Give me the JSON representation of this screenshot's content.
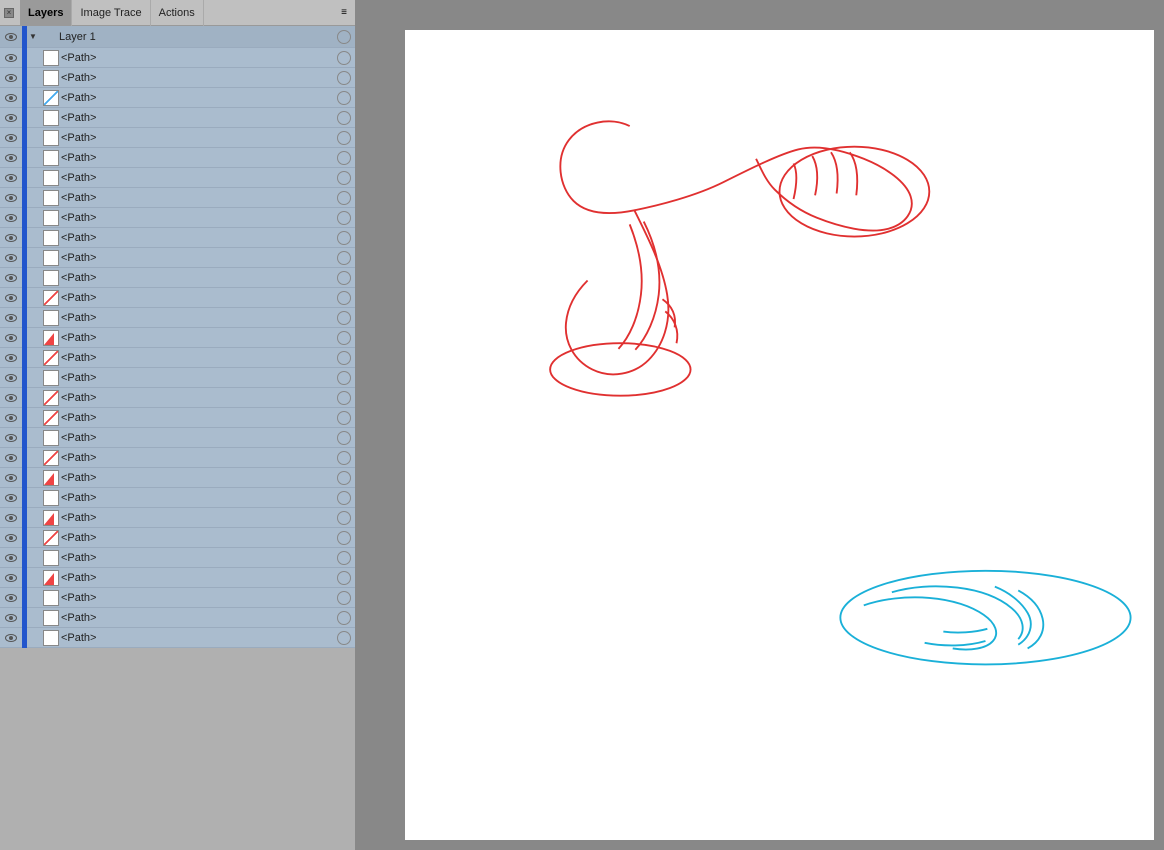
{
  "panel": {
    "tabs": [
      {
        "id": "layers",
        "label": "Layers",
        "active": true
      },
      {
        "id": "image-trace",
        "label": "Image Trace",
        "active": false
      },
      {
        "id": "actions",
        "label": "Actions",
        "active": false
      }
    ],
    "layer1_label": "Layer 1",
    "path_label": "<Path>",
    "scrollbar_present": true
  },
  "paths": [
    {
      "thumb_type": "white"
    },
    {
      "thumb_type": "white"
    },
    {
      "thumb_type": "blue-stripe"
    },
    {
      "thumb_type": "white"
    },
    {
      "thumb_type": "white"
    },
    {
      "thumb_type": "white"
    },
    {
      "thumb_type": "white"
    },
    {
      "thumb_type": "white"
    },
    {
      "thumb_type": "white"
    },
    {
      "thumb_type": "white"
    },
    {
      "thumb_type": "white"
    },
    {
      "thumb_type": "white"
    },
    {
      "thumb_type": "red-triangle"
    },
    {
      "thumb_type": "white"
    },
    {
      "thumb_type": "red-triangle"
    },
    {
      "thumb_type": "red-stripe"
    },
    {
      "thumb_type": "white"
    },
    {
      "thumb_type": "red-stripe"
    },
    {
      "thumb_type": "red-stripe"
    },
    {
      "thumb_type": "white"
    },
    {
      "thumb_type": "red-stripe"
    },
    {
      "thumb_type": "red-triangle"
    },
    {
      "thumb_type": "white"
    },
    {
      "thumb_type": "red-triangle"
    },
    {
      "thumb_type": "red-stripe"
    },
    {
      "thumb_type": "white"
    },
    {
      "thumb_type": "red-triangle"
    },
    {
      "thumb_type": "white"
    },
    {
      "thumb_type": "white"
    },
    {
      "thumb_type": "white"
    }
  ],
  "canvas": {
    "bg_color": "#888888",
    "artboard_color": "#ffffff"
  }
}
